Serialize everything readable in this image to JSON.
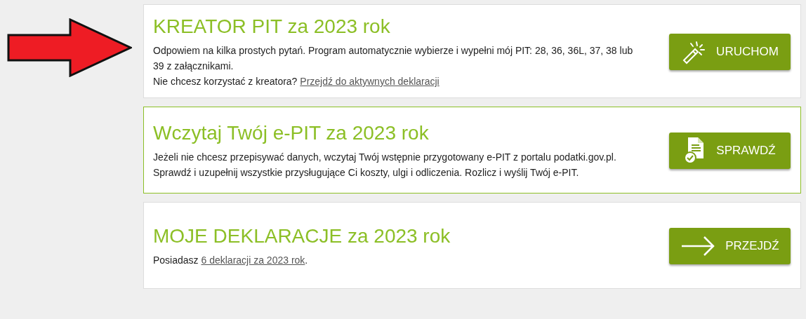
{
  "cards": [
    {
      "title": "KREATOR PIT za 2023 rok",
      "highlighted": false,
      "lines": [
        {
          "text": "Odpowiem na kilka prostych pytań. Program automatycznie wybierze i wypełni mój PIT: 28, 36, 36L, 37, 38 lub 39 z załącznikami."
        },
        {
          "text": "Nie chcesz korzystać z kreatora?",
          "link": "Przejdź do aktywnych deklaracji"
        }
      ],
      "button": {
        "label": "URUCHOM",
        "kind": "wand"
      }
    },
    {
      "title": "Wczytaj Twój e-PIT za 2023 rok",
      "highlighted": true,
      "lines": [
        {
          "text": "Jeżeli nie chcesz przepisywać danych, wczytaj Twój wstępnie przygotowany e-PIT z portalu podatki.gov.pl. Sprawdź i uzupełnij wszystkie przysługujące Ci koszty, ulgi i odliczenia. Rozlicz i wyślij Twój e-PIT."
        }
      ],
      "button": {
        "label": "SPRAWDŹ",
        "kind": "document-check"
      }
    },
    {
      "title": "MOJE DEKLARACJE za 2023 rok",
      "highlighted": false,
      "lines": [
        {
          "text": "Posiadasz",
          "link": "6 deklaracji za 2023 rok",
          "after": "."
        }
      ],
      "button": {
        "label": "PRZEJDŹ",
        "kind": "arrow"
      }
    }
  ]
}
